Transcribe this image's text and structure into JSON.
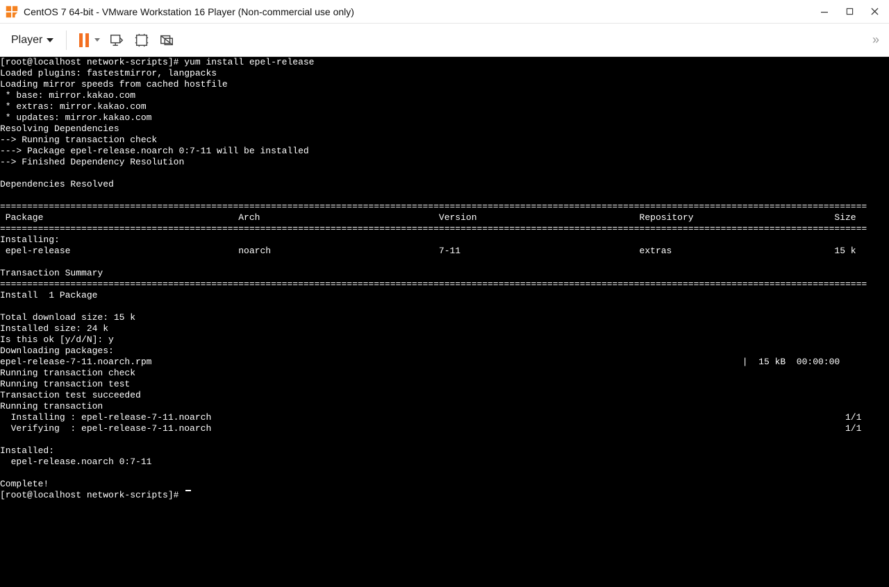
{
  "window": {
    "title": "CentOS 7 64-bit - VMware Workstation 16 Player (Non-commercial use only)"
  },
  "toolbar": {
    "player_label": "Player",
    "overflow_glyph": "»"
  },
  "terminal": {
    "body": "[root@localhost network-scripts]# yum install epel-release\nLoaded plugins: fastestmirror, langpacks\nLoading mirror speeds from cached hostfile\n * base: mirror.kakao.com\n * extras: mirror.kakao.com\n * updates: mirror.kakao.com\nResolving Dependencies\n--> Running transaction check\n---> Package epel-release.noarch 0:7-11 will be installed\n--> Finished Dependency Resolution\n\nDependencies Resolved\n\n================================================================================================================================================================\n Package                                    Arch                                 Version                              Repository                          Size\n================================================================================================================================================================\nInstalling:\n epel-release                               noarch                               7-11                                 extras                              15 k\n\nTransaction Summary\n================================================================================================================================================================\nInstall  1 Package\n\nTotal download size: 15 k\nInstalled size: 24 k\nIs this ok [y/d/N]: y\nDownloading packages:\nepel-release-7-11.noarch.rpm                                                                                                             |  15 kB  00:00:00\nRunning transaction check\nRunning transaction test\nTransaction test succeeded\nRunning transaction\n  Installing : epel-release-7-11.noarch                                                                                                                     1/1\n  Verifying  : epel-release-7-11.noarch                                                                                                                     1/1\n\nInstalled:\n  epel-release.noarch 0:7-11\n\nComplete!",
    "prompt": "[root@localhost network-scripts]# "
  }
}
